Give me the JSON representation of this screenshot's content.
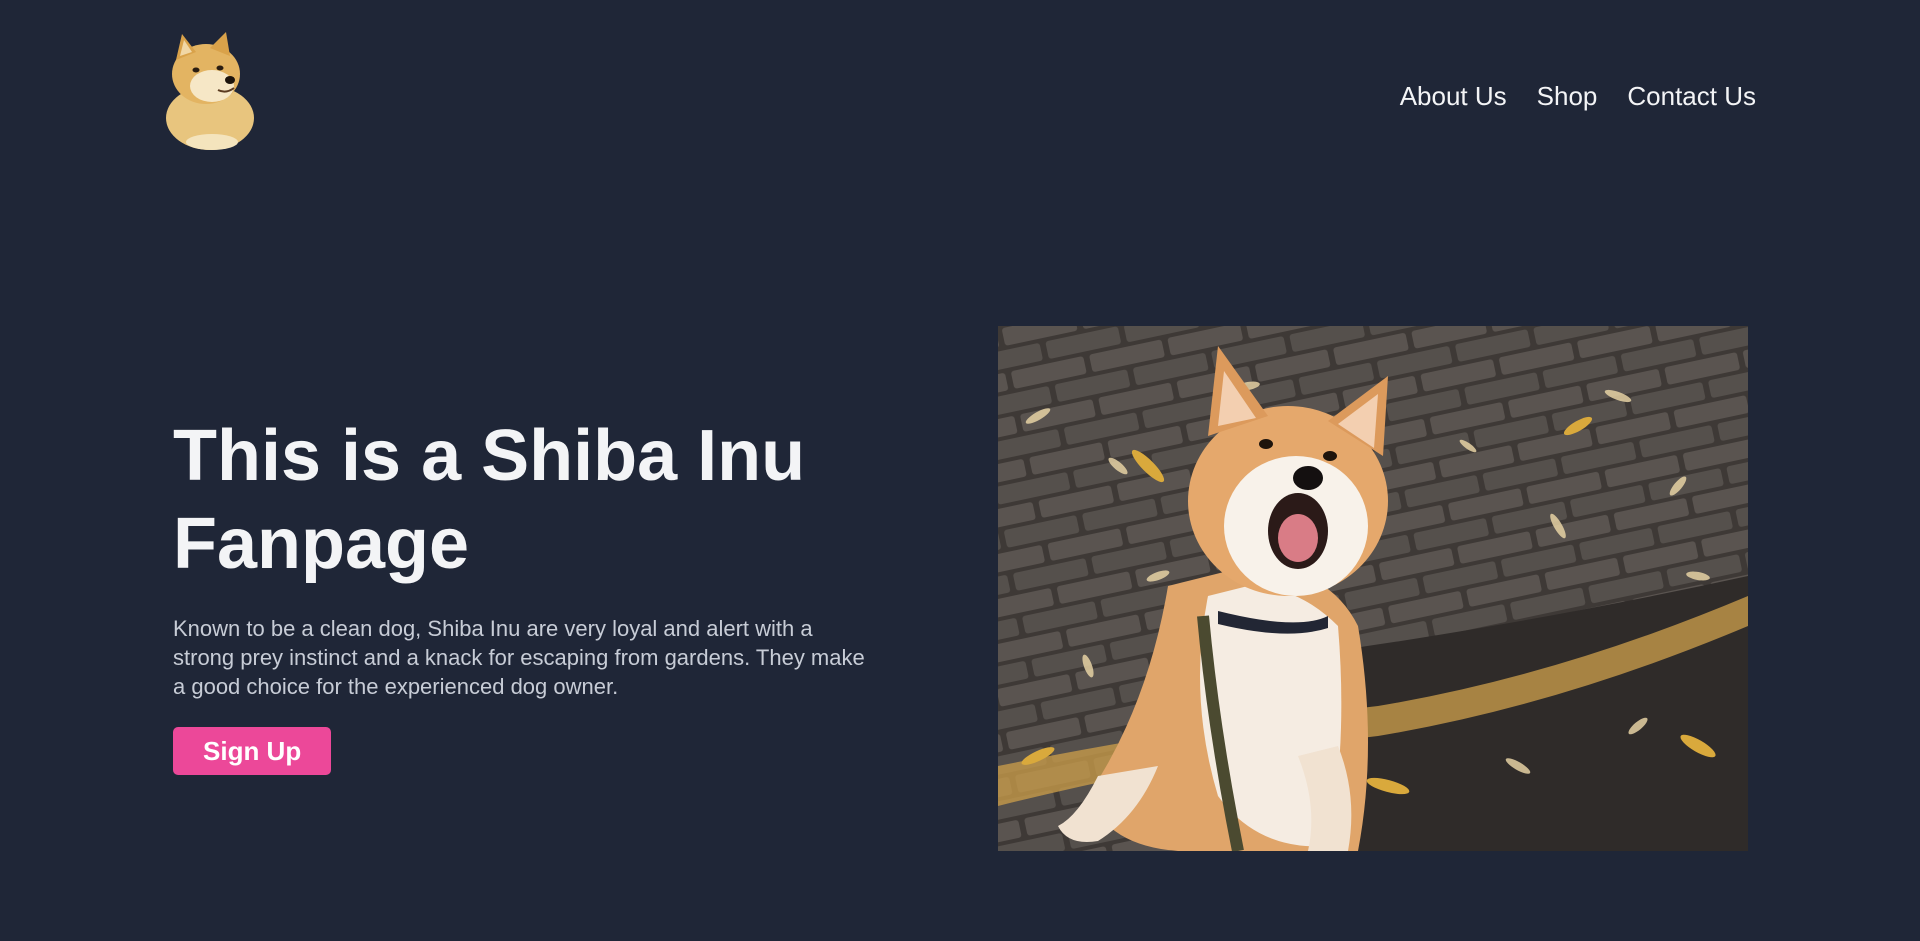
{
  "header": {
    "logo_alt": "Doge Shiba Inu logo",
    "nav": [
      {
        "label": "About Us"
      },
      {
        "label": "Shop"
      },
      {
        "label": "Contact Us"
      }
    ]
  },
  "hero": {
    "title": "This is a Shiba Inu Fanpage",
    "description": "Known to be a clean dog, Shiba Inu are very loyal and alert with a strong prey instinct and a knack for escaping from gardens. They make a good choice for the experienced dog owner.",
    "cta_label": "Sign Up",
    "photo_alt": "Shiba Inu barking among falling leaves"
  },
  "colors": {
    "background": "#1f2637",
    "accent": "#ec4899",
    "text": "#f3f4f6",
    "muted_text": "#c7ccd6"
  }
}
